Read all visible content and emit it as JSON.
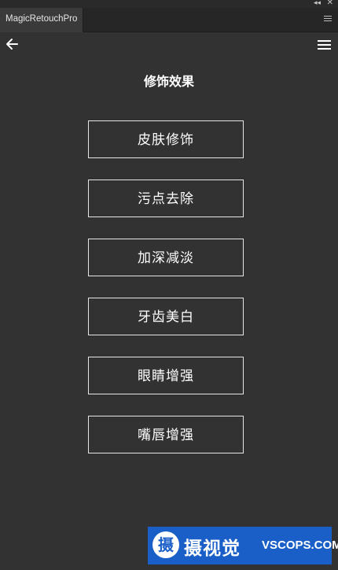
{
  "window": {
    "collapse_icon": "double-chevron-left-icon",
    "close_icon": "close-icon"
  },
  "tab": {
    "label": "MagicRetouchPro",
    "menu_icon": "panel-menu-icon"
  },
  "header": {
    "back_icon": "arrow-left-icon",
    "menu_icon": "hamburger-icon",
    "title": "修饰效果"
  },
  "menu": {
    "items": [
      {
        "label": "皮肤修饰"
      },
      {
        "label": "污点去除"
      },
      {
        "label": "加深减淡"
      },
      {
        "label": "牙齿美白"
      },
      {
        "label": "眼睛增强"
      },
      {
        "label": "嘴唇增强"
      }
    ]
  },
  "watermark": {
    "badge": "摄",
    "name": "摄视觉",
    "domain": "VSCOPS.COM",
    "color": "#1a5fc7"
  },
  "colors": {
    "background": "#323232",
    "tab_bar": "#262626",
    "tab_active": "#3a3a3a",
    "button_border": "#e6e6e6"
  }
}
